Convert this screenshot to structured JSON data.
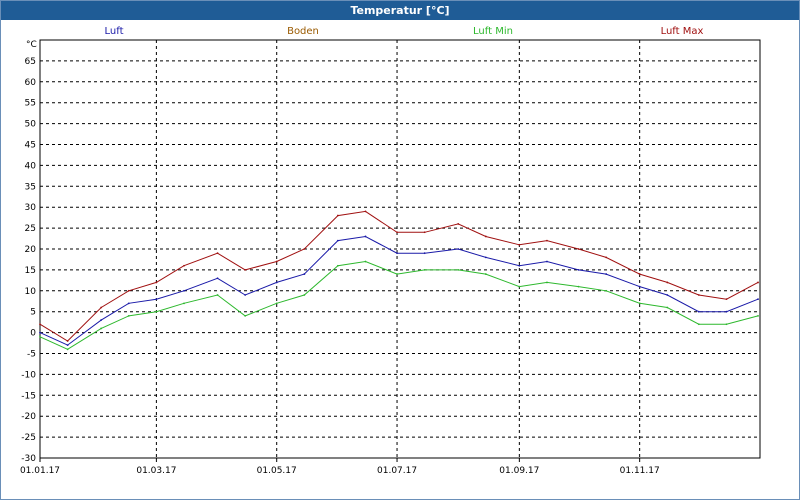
{
  "window": {
    "title": "Temperatur [°C]"
  },
  "chart_data": {
    "type": "line",
    "title": "Temperatur [°C]",
    "ylabel": "°C",
    "xlabel": "",
    "ylim": [
      -30,
      70
    ],
    "yticks": [
      65,
      60,
      55,
      50,
      45,
      40,
      35,
      30,
      25,
      20,
      15,
      10,
      5,
      0,
      -5,
      -10,
      -15,
      -20,
      -25,
      -30
    ],
    "xlim": [
      "01.01.17",
      "31.12.17"
    ],
    "xticks": [
      "01.01.17",
      "01.03.17",
      "01.05.17",
      "01.07.17",
      "01.09.17",
      "01.11.17"
    ],
    "grid": true,
    "legend_position": "top",
    "x_dates": [
      "01.01.17",
      "15.01.17",
      "01.02.17",
      "15.02.17",
      "01.03.17",
      "15.03.17",
      "01.04.17",
      "15.04.17",
      "01.05.17",
      "15.05.17",
      "01.06.17",
      "15.06.17",
      "01.07.17",
      "15.07.17",
      "01.08.17",
      "15.08.17",
      "01.09.17",
      "15.09.17",
      "01.10.17",
      "15.10.17",
      "01.11.17",
      "15.11.17",
      "01.12.17",
      "15.12.17",
      "31.12.17"
    ],
    "series": [
      {
        "name": "Luft",
        "color": "#1a1aa8",
        "values": [
          0,
          -3,
          3,
          7,
          8,
          10,
          13,
          9,
          12,
          14,
          22,
          23,
          19,
          19,
          20,
          18,
          16,
          17,
          15,
          14,
          11,
          9,
          5,
          5,
          8
        ]
      },
      {
        "name": "Boden",
        "color": "#9a5a00",
        "values": []
      },
      {
        "name": "Luft Min",
        "color": "#2db82d",
        "values": [
          -1,
          -4,
          1,
          4,
          5,
          7,
          9,
          4,
          7,
          9,
          16,
          17,
          14,
          15,
          15,
          14,
          11,
          12,
          11,
          10,
          7,
          6,
          2,
          2,
          4
        ]
      },
      {
        "name": "Luft Max",
        "color": "#a01010",
        "values": [
          2,
          -2,
          6,
          10,
          12,
          16,
          19,
          15,
          17,
          20,
          28,
          29,
          24,
          24,
          26,
          23,
          21,
          22,
          20,
          18,
          14,
          12,
          9,
          8,
          12
        ]
      }
    ]
  }
}
